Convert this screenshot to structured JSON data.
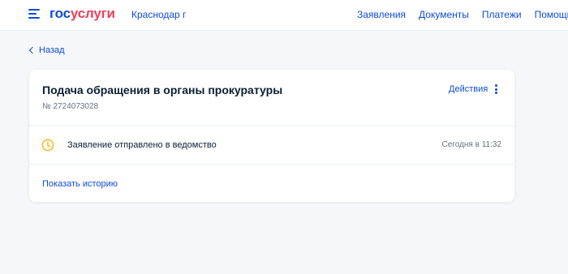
{
  "header": {
    "logo_part1": "гос",
    "logo_part2": "услуги",
    "region": "Краснодар г",
    "nav": [
      "Заявления",
      "Документы",
      "Платежи",
      "Помощь"
    ]
  },
  "back": {
    "label": "Назад"
  },
  "card": {
    "title": "Подача обращения в органы прокуратуры",
    "number": "№ 2724073028",
    "actions_label": "Действия",
    "status": {
      "text": "Заявление отправлено в ведомство",
      "time": "Сегодня в 11:32",
      "icon": "clock-icon",
      "icon_color": "#f5bc2a"
    },
    "history_label": "Показать историю"
  },
  "colors": {
    "accent": "#0d4cd3",
    "brand_red": "#ee3f58",
    "text": "#0b1f33",
    "muted": "#66727f",
    "background": "#f5f7fa"
  }
}
